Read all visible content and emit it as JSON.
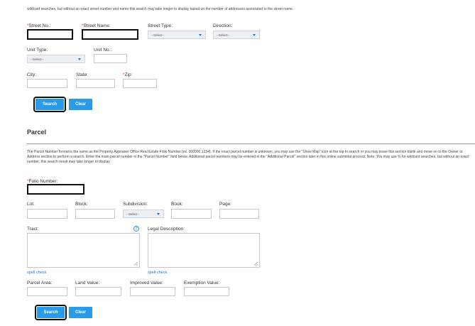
{
  "address": {
    "note": "wildcard searches, but without an exact street number and name this search may take longer to display based on the number of addresses associated to the street name.",
    "street_no_label": "Street No.:",
    "street_name_label": "Street Name:",
    "street_type_label": "Street Type:",
    "street_type_value": "--Select--",
    "direction_label": "Direction:",
    "direction_value": "--Select--",
    "unit_type_label": "Unit Type:",
    "unit_type_value": "--Select--",
    "unit_no_label": "Unit No.:",
    "city_label": "City:",
    "state_label": "State:",
    "zip_label": "Zip:",
    "required_mark": "*"
  },
  "address_actions": {
    "search_label": "Search",
    "clear_label": "Clear"
  },
  "parcel": {
    "heading": "Parcel",
    "note": "The Parcel Number format is the same as the Property Appraiser Office Real Estate Folio Number (ex. 000000.1234). If the exact parcel number is unknown, you may use the \"Show Map\" icon at the top to search or you may leave this section blank and move on to the Owner or Address section to perform a search. Enter the main parcel number in the \"Parcel Number\" field below. Additional parcel numbers may be entered in the \"Additional Parcel\" section later in this online submittal process. Note: You may use % for wildcard searches, but without an exact number, this search result may take longer to display.",
    "folio_label": "Folio Number:",
    "required_mark": "*",
    "lot_label": "Lot:",
    "block_label": "Block:",
    "subdivision_label": "Subdivision:",
    "subdivision_value": "--Select--",
    "book_label": "Book:",
    "page_label": "Page:",
    "tract_label": "Tract:",
    "info_glyph": "?",
    "legal_label": "Legal Description:",
    "spell_check_1": "spell check",
    "spell_check_2": "spell check",
    "parcel_area_label": "Parcel Area:",
    "land_value_label": "Land Value:",
    "improved_value_label": "Improved Value:",
    "exemption_value_label": "Exemption Value:"
  },
  "parcel_actions": {
    "search_label": "Search",
    "clear_label": "Clear"
  },
  "colors": {
    "accent": "#2a9be9",
    "required": "#e0312a",
    "link": "#1a73d9"
  }
}
